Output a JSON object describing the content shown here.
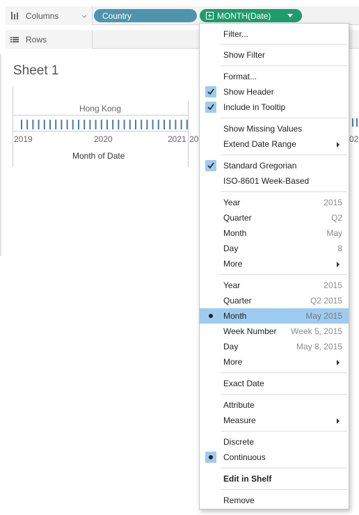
{
  "shelves": {
    "columns_label": "Columns",
    "rows_label": "Rows",
    "columns_icon": "columns-icon",
    "rows_icon": "rows-icon"
  },
  "pills": {
    "country": "Country",
    "month_date": "MONTH(Date)"
  },
  "sheet": {
    "title": "Sheet 1",
    "header": "Hong Kong",
    "years": [
      "2019",
      "2020",
      "2021",
      "20",
      "02"
    ],
    "axis_title": "Month of Date"
  },
  "menu": {
    "filter": "Filter...",
    "show_filter": "Show Filter",
    "format": "Format...",
    "show_header": "Show Header",
    "include_tooltip": "Include in Tooltip",
    "show_missing": "Show Missing Values",
    "extend_range": "Extend Date Range",
    "standard_gregorian": "Standard Gregorian",
    "iso_week": "ISO-8601 Week-Based",
    "discrete_group": [
      {
        "label": "Year",
        "value": "2015"
      },
      {
        "label": "Quarter",
        "value": "Q2"
      },
      {
        "label": "Month",
        "value": "May"
      },
      {
        "label": "Day",
        "value": "8"
      },
      {
        "label": "More",
        "value": ""
      }
    ],
    "continuous_group": [
      {
        "label": "Year",
        "value": "2015"
      },
      {
        "label": "Quarter",
        "value": "Q2 2015"
      },
      {
        "label": "Month",
        "value": "May 2015"
      },
      {
        "label": "Week Number",
        "value": "Week 5, 2015"
      },
      {
        "label": "Day",
        "value": "May 8, 2015"
      },
      {
        "label": "More",
        "value": ""
      }
    ],
    "exact_date": "Exact Date",
    "attribute": "Attribute",
    "measure": "Measure",
    "discrete": "Discrete",
    "continuous": "Continuous",
    "edit_in_shelf": "Edit in Shelf",
    "remove": "Remove"
  },
  "colors": {
    "dimension_pill": "#4d95ae",
    "continuous_pill": "#1f9b6c",
    "menu_highlight": "#9ecbf0",
    "tick_color": "#4e79a7"
  }
}
